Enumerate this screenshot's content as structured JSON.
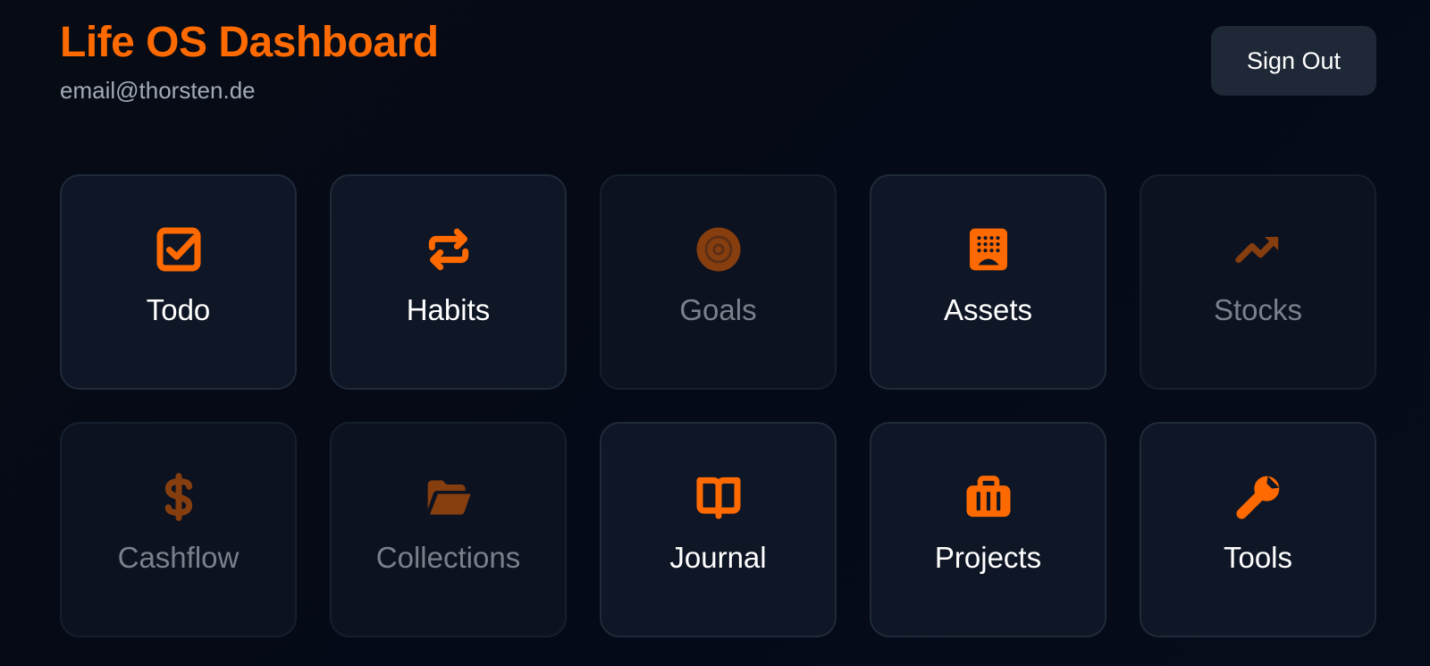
{
  "header": {
    "title": "Life OS Dashboard",
    "email": "email@thorsten.de",
    "sign_out_label": "Sign Out"
  },
  "colors": {
    "accent": "#ff6a00",
    "background": "#050a18",
    "card": "#0f1626",
    "button": "#1e2837"
  },
  "tiles": [
    {
      "label": "Todo",
      "icon": "checkbox-icon",
      "enabled": true
    },
    {
      "label": "Habits",
      "icon": "repeat-icon",
      "enabled": true
    },
    {
      "label": "Goals",
      "icon": "target-icon",
      "enabled": false
    },
    {
      "label": "Assets",
      "icon": "building-icon",
      "enabled": true
    },
    {
      "label": "Stocks",
      "icon": "trending-up-icon",
      "enabled": false
    },
    {
      "label": "Cashflow",
      "icon": "dollar-icon",
      "enabled": false
    },
    {
      "label": "Collections",
      "icon": "folder-open-icon",
      "enabled": false
    },
    {
      "label": "Journal",
      "icon": "book-open-icon",
      "enabled": true
    },
    {
      "label": "Projects",
      "icon": "briefcase-icon",
      "enabled": true
    },
    {
      "label": "Tools",
      "icon": "wrench-icon",
      "enabled": true
    }
  ]
}
